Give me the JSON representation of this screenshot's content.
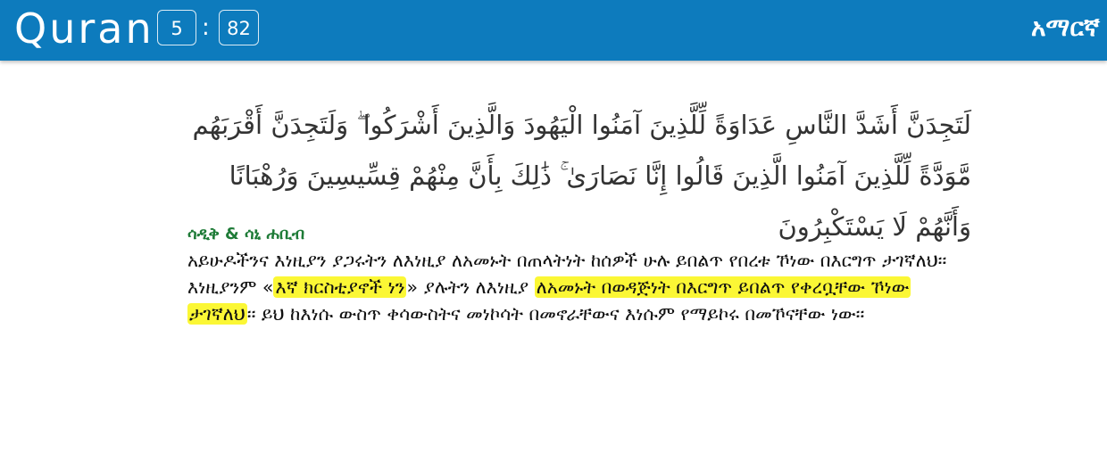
{
  "header": {
    "app_title": "Quran",
    "chapter": "5",
    "separator": ":",
    "verse": "82",
    "language": "አማርኛ"
  },
  "verse": {
    "arabic": "لَتَجِدَنَّ أَشَدَّ النَّاسِ عَدَاوَةً لِّلَّذِينَ آمَنُوا الْيَهُودَ وَالَّذِينَ أَشْرَكُوا ۖ وَلَتَجِدَنَّ أَقْرَبَهُم مَّوَدَّةً لِّلَّذِينَ آمَنُوا الَّذِينَ قَالُوا إِنَّا نَصَارَىٰ ۚ ذَٰلِكَ بِأَنَّ مِنْهُمْ قِسِّيسِينَ وَرُهْبَانًا وَأَنَّهُمْ لَا يَسْتَكْبِرُونَ",
    "translator": "ሳዲቅ & ሳኒ ሐቢብ",
    "translation": {
      "part1": "አይሁዶችንና እነዚያን ያጋሩትን ለእነዚያ ለአመኑት በጠላትነት ከሰዎች ሁሉ ይበልጥ የበረቱ ኾነው በእርግጥ ታገኛለህ፡፡ እነዚያንም «",
      "highlight1": "እኛ ክርስቲያኖች ነን",
      "part2": "» ያሉትን ለእነዚያ ",
      "highlight2": "ለአመኑት በወዳጅነት በእርግጥ ይበልጥ የቀረቧቸው ኾነው ታገኛለህ",
      "part3": "፡፡ ይህ ከእነሱ ውስጥ ቀሳውስትና መነኮሳት በመኖራቸውና እነሱም የማይኮሩ በመኾናቸው ነው፡፡"
    },
    "highlight_color": "#fbf735"
  },
  "colors": {
    "header_bg": "#0d7bbd",
    "translator_name": "#1e7b37"
  }
}
